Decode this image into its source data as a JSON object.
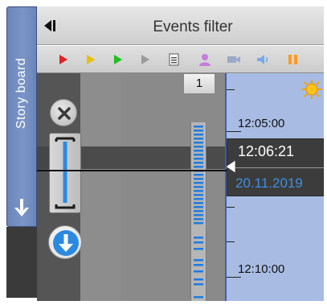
{
  "storyboard": {
    "label": "Story board",
    "arrow_icon": "arrow-down-icon"
  },
  "header": {
    "title": "Events filter",
    "collapse_icon": "collapse-left-icon"
  },
  "event_icons": [
    {
      "name": "play-red-icon",
      "color": "#e02020"
    },
    {
      "name": "play-yellow-icon",
      "color": "#e8c000"
    },
    {
      "name": "play-green-icon",
      "color": "#1fbf1f"
    },
    {
      "name": "play-gray-icon",
      "color": "#9a9a9a"
    },
    {
      "name": "document-icon",
      "color": "#ffffff"
    },
    {
      "name": "user-icon",
      "color": "#c77ae0"
    },
    {
      "name": "camera-icon",
      "color": "#9aa9c9"
    },
    {
      "name": "speaker-icon",
      "color": "#7aa8e8"
    },
    {
      "name": "pause-icon",
      "color": "#ff9a1f"
    }
  ],
  "controls": {
    "close_icon": "close-icon",
    "zoom_icon": "zoom-range-icon",
    "scroll_icon": "scroll-down-icon"
  },
  "page_number": "1",
  "timescale": {
    "top_label": "12:05:00",
    "bottom_label": "12:10:00",
    "current_time": "12:06:21",
    "current_date": "20.11.2019",
    "daytime_icon": "sun-icon"
  },
  "colors": {
    "accent": "#3f8fe0",
    "tab": "#7a95c8",
    "scale": "#a8bce3"
  }
}
